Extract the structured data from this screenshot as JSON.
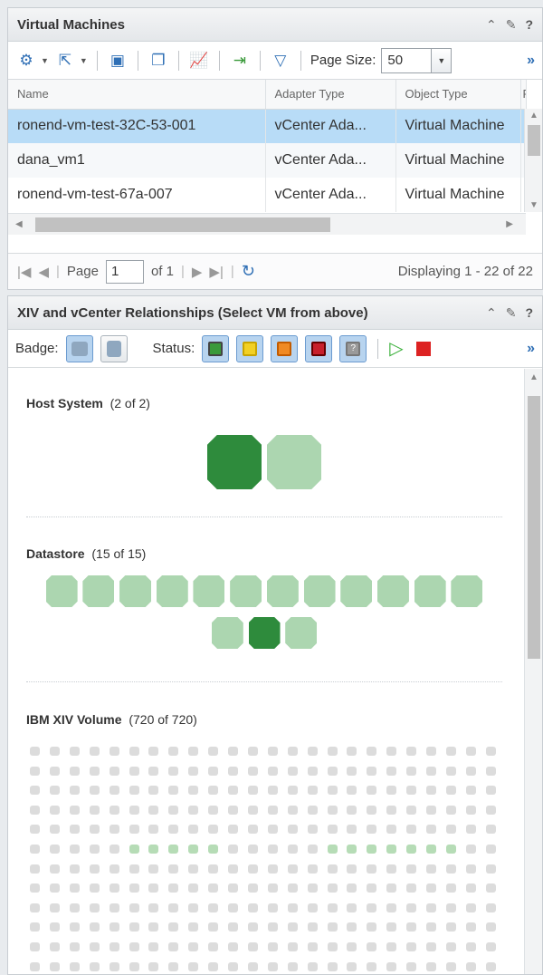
{
  "vm_panel": {
    "title": "Virtual Machines",
    "toolbar": {
      "page_size_label": "Page Size:",
      "page_size_value": "50",
      "more": "»"
    },
    "columns": [
      "Name",
      "Adapter Type",
      "Object Type",
      "P"
    ],
    "rows": [
      {
        "name": "ronend-vm-test-32C-53-001",
        "adapter": "vCenter Ada...",
        "object": "Virtual Machine",
        "selected": true
      },
      {
        "name": "dana_vm1",
        "adapter": "vCenter Ada...",
        "object": "Virtual Machine",
        "selected": false
      },
      {
        "name": "ronend-vm-test-67a-007",
        "adapter": "vCenter Ada...",
        "object": "Virtual Machine",
        "selected": false
      }
    ],
    "pager": {
      "page_label": "Page",
      "page_value": "1",
      "of_label": "of 1",
      "display_text": "Displaying 1 - 22 of 22"
    }
  },
  "rel_panel": {
    "title": "XIV and vCenter Relationships (Select VM from above)",
    "badge_label": "Badge:",
    "status_label": "Status:",
    "more": "»",
    "status_colors": [
      "#3a9a3a",
      "#f2d024",
      "#f08a24",
      "#c8202c",
      "#9a9a9a"
    ],
    "sections": {
      "host": {
        "name": "Host System",
        "count": "(2 of 2)",
        "total": 2,
        "selected": [
          0
        ]
      },
      "datastore": {
        "name": "Datastore",
        "count": "(15 of 15)",
        "total": 15,
        "selected": [
          13
        ]
      },
      "volume": {
        "name": "IBM XIV Volume",
        "count": "(720 of 720)",
        "total": 720
      }
    },
    "colors": {
      "selected": "#2e8b3c",
      "unselected": "#acd6b0",
      "volume": "#dcdcdc",
      "volume_highlight": "#b6dcb6"
    }
  }
}
